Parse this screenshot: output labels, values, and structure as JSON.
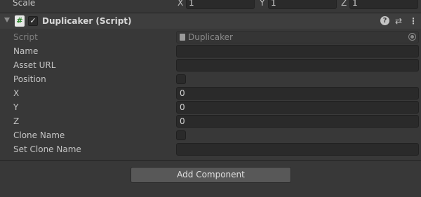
{
  "scale_row": {
    "label": "Scale",
    "x_axis": "X",
    "x_value": "1",
    "y_axis": "Y",
    "y_value": "1",
    "z_axis": "Z",
    "z_value": "1"
  },
  "component": {
    "icon_glyph": "#",
    "enabled": "✓",
    "title": "Duplicaker (Script)",
    "help_glyph": "?",
    "preset_glyph": "⇄",
    "menu_glyph": "⋮"
  },
  "properties": [
    {
      "label": "Script",
      "type": "object",
      "value": "Duplicaker",
      "disabled": true
    },
    {
      "label": "Name",
      "type": "text",
      "value": ""
    },
    {
      "label": "Asset URL",
      "type": "text",
      "value": ""
    },
    {
      "label": "Position",
      "type": "checkbox",
      "checked": false
    },
    {
      "label": "X",
      "type": "text",
      "value": "0"
    },
    {
      "label": "Y",
      "type": "text",
      "value": "0"
    },
    {
      "label": "Z",
      "type": "text",
      "value": "0"
    },
    {
      "label": "Clone Name",
      "type": "checkbox",
      "checked": false
    },
    {
      "label": "Set Clone Name",
      "type": "text",
      "value": ""
    }
  ],
  "add_component_label": "Add Component"
}
